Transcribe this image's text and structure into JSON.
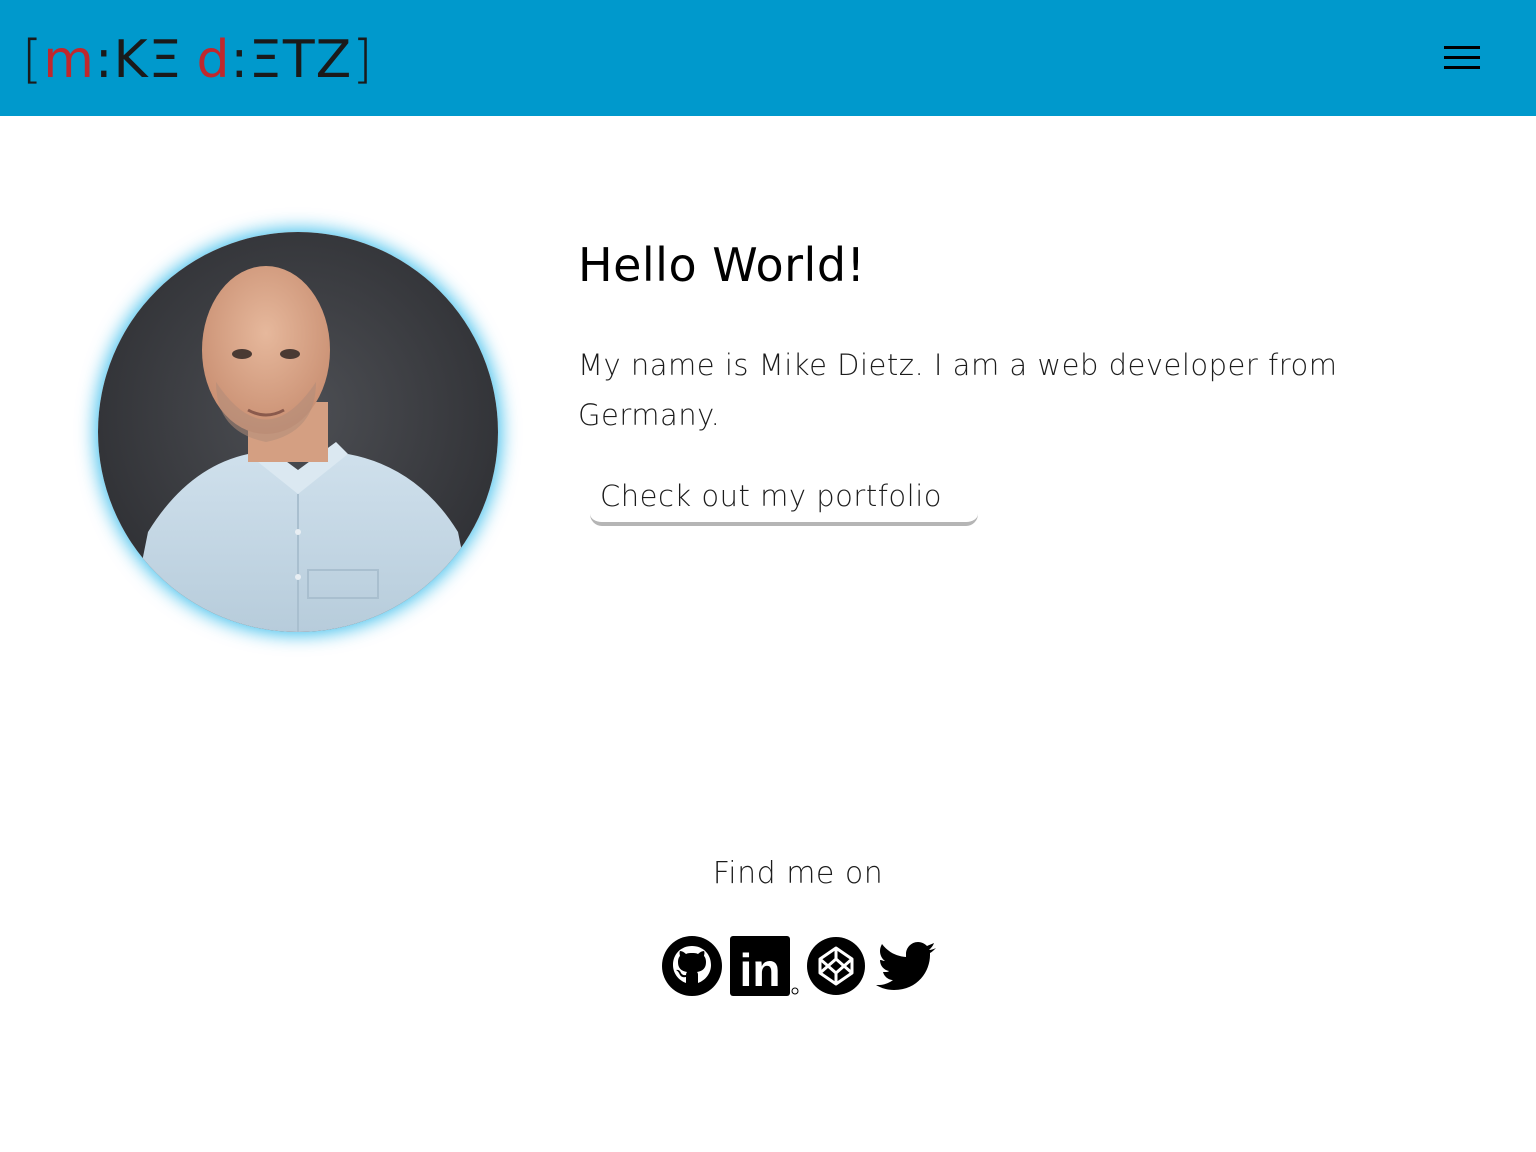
{
  "header": {
    "logo": {
      "open_bracket": "[",
      "first_name_part1": "m",
      "first_name_part2": ":KΞ",
      "last_name_part1": "d",
      "last_name_part2": ":ΞTZ",
      "close_bracket": "]"
    },
    "menu_icon": "hamburger-icon",
    "colors": {
      "background": "#0099cc",
      "logo_red": "#c0282d",
      "logo_dark": "#1a1a1a"
    }
  },
  "hero": {
    "title": "Hello World!",
    "intro": "My name is Mike Dietz. I am a web developer from Germany.",
    "cta_label": "Check out my portfolio",
    "avatar_glow_color": "#00aae6"
  },
  "social": {
    "heading": "Find me on",
    "links": [
      {
        "icon": "github-icon"
      },
      {
        "icon": "linkedin-icon",
        "text": "in"
      },
      {
        "icon": "codepen-icon"
      },
      {
        "icon": "twitter-icon"
      }
    ]
  }
}
